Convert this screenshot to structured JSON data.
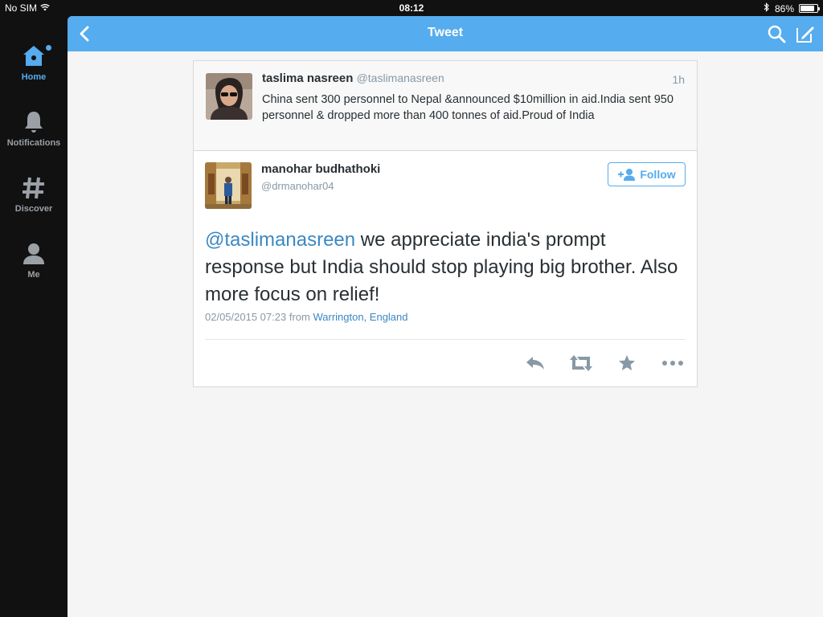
{
  "status_bar": {
    "carrier": "No SIM",
    "time": "08:12",
    "battery_percent": "86%",
    "battery_level": 0.86
  },
  "sidebar": {
    "items": [
      {
        "label": "Home",
        "icon": "home-icon",
        "active": true
      },
      {
        "label": "Notifications",
        "icon": "bell-icon",
        "active": false
      },
      {
        "label": "Discover",
        "icon": "hashtag-icon",
        "active": false
      },
      {
        "label": "Me",
        "icon": "person-icon",
        "active": false
      }
    ]
  },
  "topbar": {
    "title": "Tweet"
  },
  "parent_tweet": {
    "display_name": "taslima nasreen",
    "handle": "@taslimanasreen",
    "relative_time": "1h",
    "text": "China sent 300 personnel to Nepal &announced $10million in aid.India sent 950 personnel & dropped more than 400 tonnes of aid.Proud of India"
  },
  "main_tweet": {
    "display_name": "manohar budhathoki",
    "handle": "@drmanohar04",
    "follow_label": "Follow",
    "mention": "@taslimanasreen",
    "text": " we appreciate india's prompt response but India should stop playing big brother. Also more focus on relief!",
    "timestamp": "02/05/2015 07:23",
    "from_label": "from",
    "location": "Warrington, England"
  },
  "colors": {
    "accent": "#55acee",
    "link": "#3b88c3",
    "sidebar_bg": "#111111",
    "text": "#292f33",
    "muted": "#8899a6"
  }
}
